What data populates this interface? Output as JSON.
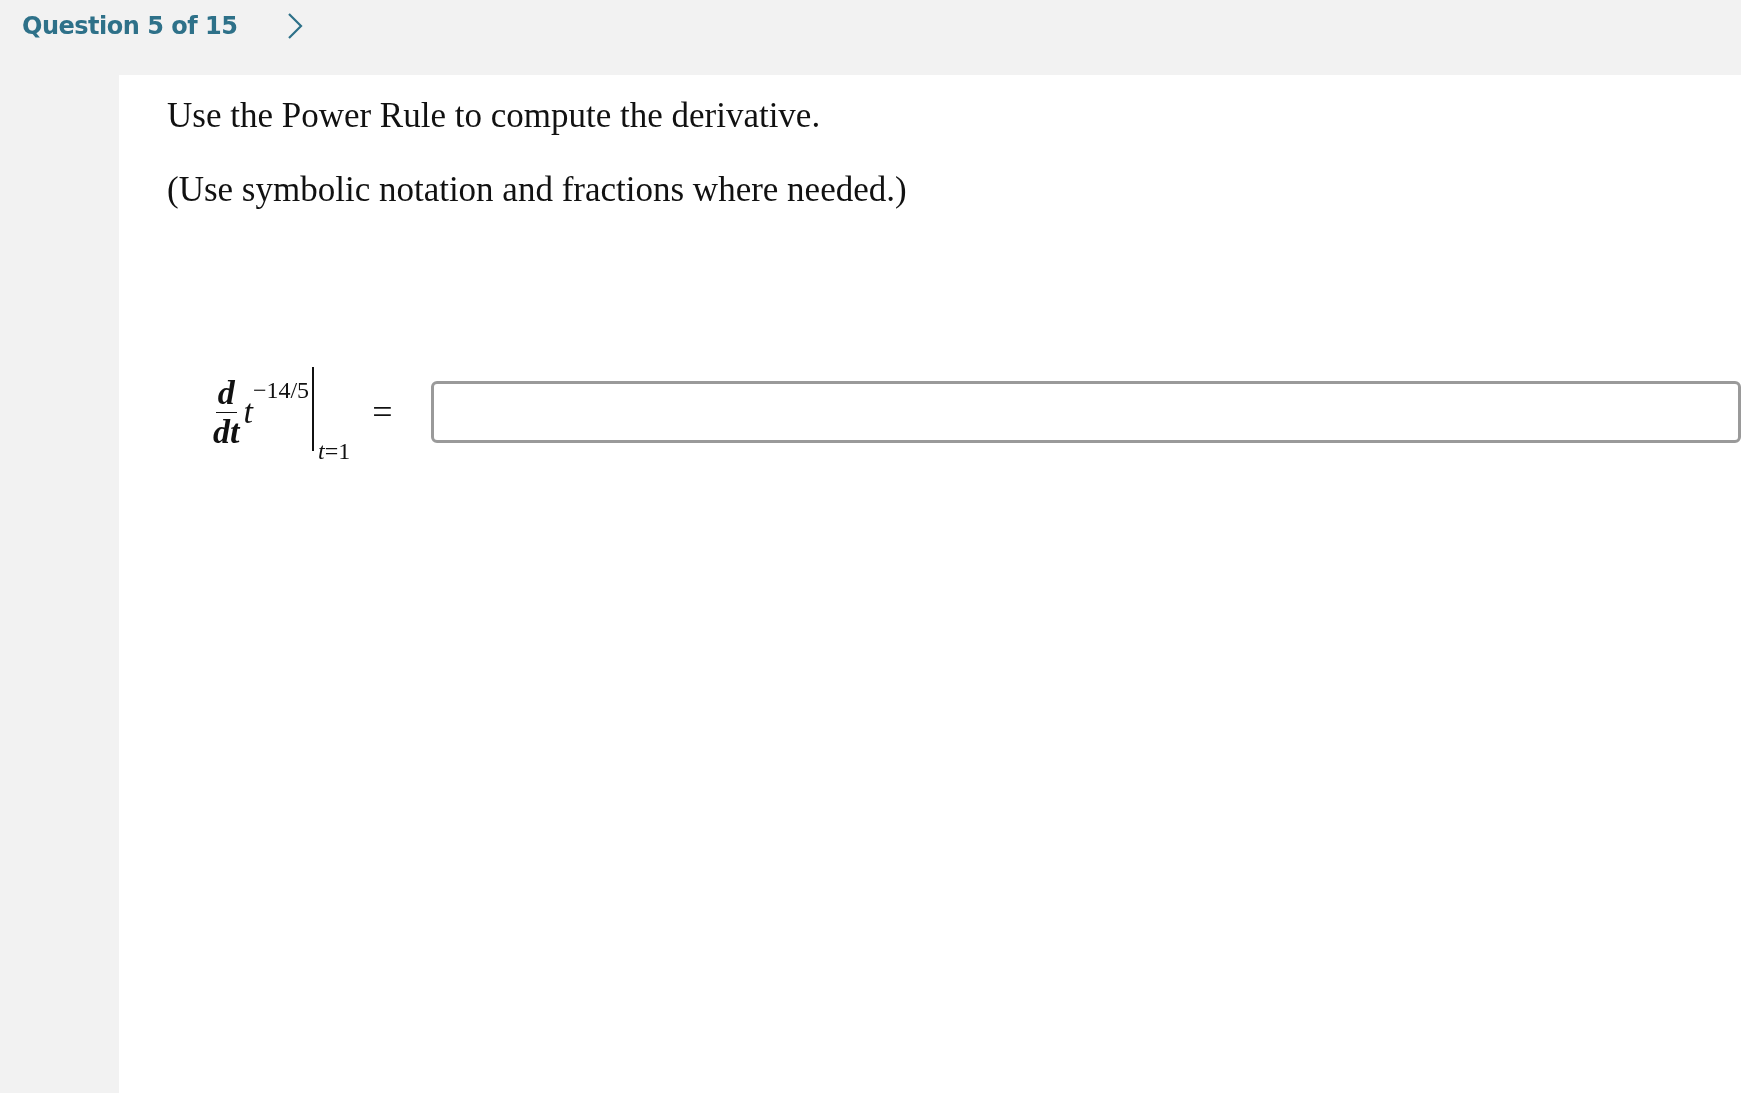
{
  "header": {
    "title": "Question 5 of 15"
  },
  "question": {
    "instructions": [
      "Use the Power Rule to compute the derivative.",
      "(Use symbolic notation and fractions where needed.)"
    ],
    "expression": {
      "numerator": "d",
      "denominator": "dt",
      "base": "t",
      "exponent": "−14/5",
      "evaluated_at": "*t*=1",
      "relation": "="
    }
  }
}
